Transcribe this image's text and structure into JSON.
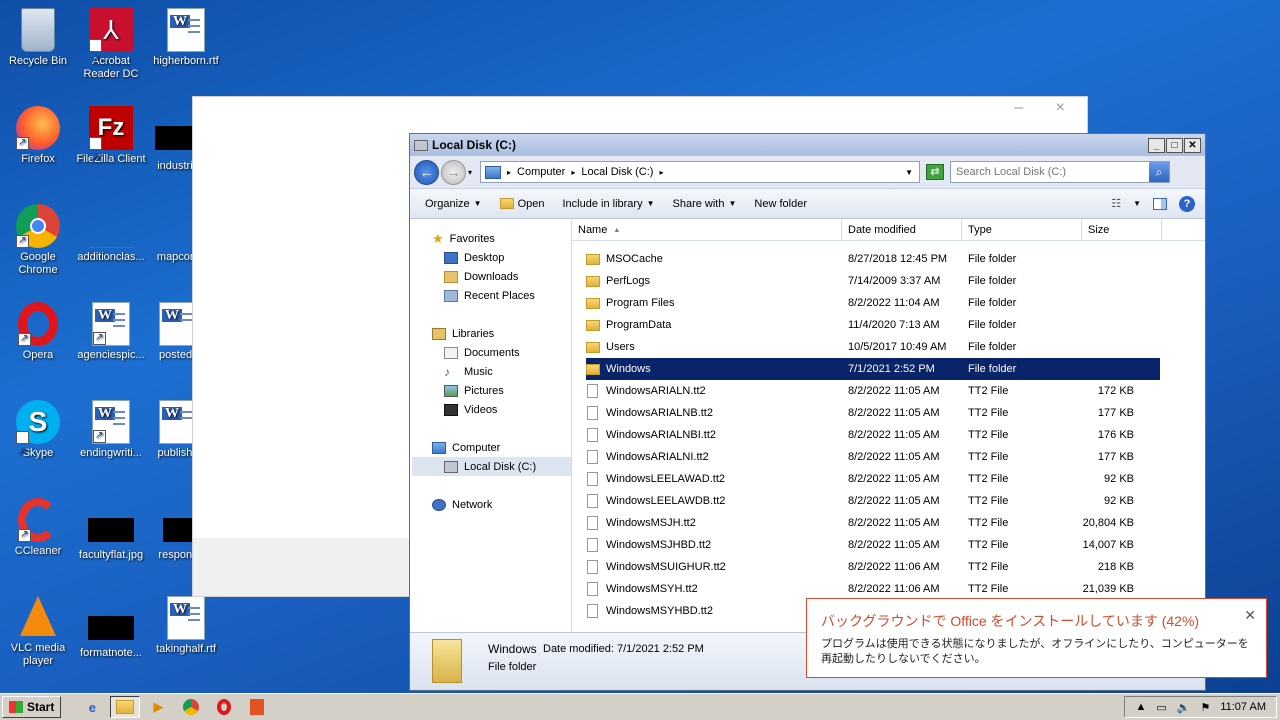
{
  "desktop": {
    "icons": [
      {
        "label": "Recycle Bin"
      },
      {
        "label": "Acrobat Reader DC"
      },
      {
        "label": "higherborn.rtf"
      },
      {
        "label": "Firefox"
      },
      {
        "label": "FileZilla Client"
      },
      {
        "label": "industria"
      },
      {
        "label": "Google Chrome"
      },
      {
        "label": "additionclas..."
      },
      {
        "label": "mapcom"
      },
      {
        "label": "Opera"
      },
      {
        "label": "agenciespic..."
      },
      {
        "label": "postedli"
      },
      {
        "label": "Skype"
      },
      {
        "label": "endingwriti..."
      },
      {
        "label": "publishe"
      },
      {
        "label": "CCleaner"
      },
      {
        "label": "facultyflat.jpg"
      },
      {
        "label": "respons"
      },
      {
        "label": "VLC media player"
      },
      {
        "label": "formatnote..."
      },
      {
        "label": "takinghalf.rtf"
      }
    ]
  },
  "blank_window": {
    "controls": "– ×"
  },
  "explorer": {
    "title": "Local Disk (C:)",
    "breadcrumb": [
      "Computer",
      "Local Disk (C:)"
    ],
    "search_placeholder": "Search Local Disk (C:)",
    "toolbar": {
      "organize": "Organize",
      "open": "Open",
      "include": "Include in library",
      "share": "Share with",
      "new_folder": "New folder"
    },
    "nav": {
      "favorites": "Favorites",
      "desktop": "Desktop",
      "downloads": "Downloads",
      "recent": "Recent Places",
      "libraries": "Libraries",
      "documents": "Documents",
      "music": "Music",
      "pictures": "Pictures",
      "videos": "Videos",
      "computer": "Computer",
      "local_disk": "Local Disk (C:)",
      "network": "Network"
    },
    "columns": {
      "name": "Name",
      "date": "Date modified",
      "type": "Type",
      "size": "Size"
    },
    "files": [
      {
        "name": "MSOCache",
        "date": "8/27/2018 12:45 PM",
        "type": "File folder",
        "size": "",
        "kind": "folder"
      },
      {
        "name": "PerfLogs",
        "date": "7/14/2009 3:37 AM",
        "type": "File folder",
        "size": "",
        "kind": "folder"
      },
      {
        "name": "Program Files",
        "date": "8/2/2022 11:04 AM",
        "type": "File folder",
        "size": "",
        "kind": "folder"
      },
      {
        "name": "ProgramData",
        "date": "11/4/2020 7:13 AM",
        "type": "File folder",
        "size": "",
        "kind": "folder"
      },
      {
        "name": "Users",
        "date": "10/5/2017 10:49 AM",
        "type": "File folder",
        "size": "",
        "kind": "folder"
      },
      {
        "name": "Windows",
        "date": "7/1/2021 2:52 PM",
        "type": "File folder",
        "size": "",
        "kind": "folder",
        "selected": true
      },
      {
        "name": "WindowsARIALN.tt2",
        "date": "8/2/2022 11:05 AM",
        "type": "TT2 File",
        "size": "172 KB",
        "kind": "file"
      },
      {
        "name": "WindowsARIALNB.tt2",
        "date": "8/2/2022 11:05 AM",
        "type": "TT2 File",
        "size": "177 KB",
        "kind": "file"
      },
      {
        "name": "WindowsARIALNBI.tt2",
        "date": "8/2/2022 11:05 AM",
        "type": "TT2 File",
        "size": "176 KB",
        "kind": "file"
      },
      {
        "name": "WindowsARIALNI.tt2",
        "date": "8/2/2022 11:05 AM",
        "type": "TT2 File",
        "size": "177 KB",
        "kind": "file"
      },
      {
        "name": "WindowsLEELAWAD.tt2",
        "date": "8/2/2022 11:05 AM",
        "type": "TT2 File",
        "size": "92 KB",
        "kind": "file"
      },
      {
        "name": "WindowsLEELAWDB.tt2",
        "date": "8/2/2022 11:05 AM",
        "type": "TT2 File",
        "size": "92 KB",
        "kind": "file"
      },
      {
        "name": "WindowsMSJH.tt2",
        "date": "8/2/2022 11:05 AM",
        "type": "TT2 File",
        "size": "20,804 KB",
        "kind": "file"
      },
      {
        "name": "WindowsMSJHBD.tt2",
        "date": "8/2/2022 11:05 AM",
        "type": "TT2 File",
        "size": "14,007 KB",
        "kind": "file"
      },
      {
        "name": "WindowsMSUIGHUR.tt2",
        "date": "8/2/2022 11:06 AM",
        "type": "TT2 File",
        "size": "218 KB",
        "kind": "file"
      },
      {
        "name": "WindowsMSYH.tt2",
        "date": "8/2/2022 11:06 AM",
        "type": "TT2 File",
        "size": "21,039 KB",
        "kind": "file"
      },
      {
        "name": "WindowsMSYHBD.tt2",
        "date": "",
        "type": "",
        "size": "",
        "kind": "file"
      }
    ],
    "details": {
      "name": "Windows",
      "date_label": "Date modified: 7/1/2021 2:52 PM",
      "type": "File folder"
    }
  },
  "toast": {
    "title": "バックグラウンドで Office をインストールしています (42%)",
    "message": "プログラムは使用できる状態になりましたが、オフラインにしたり、コンピューターを再起動したりしないでください。",
    "progress_percent": 42
  },
  "taskbar": {
    "start": "Start",
    "clock": "11:07 AM"
  },
  "colors": {
    "selection": "#0a246a",
    "toast_accent": "#d24a2b"
  }
}
